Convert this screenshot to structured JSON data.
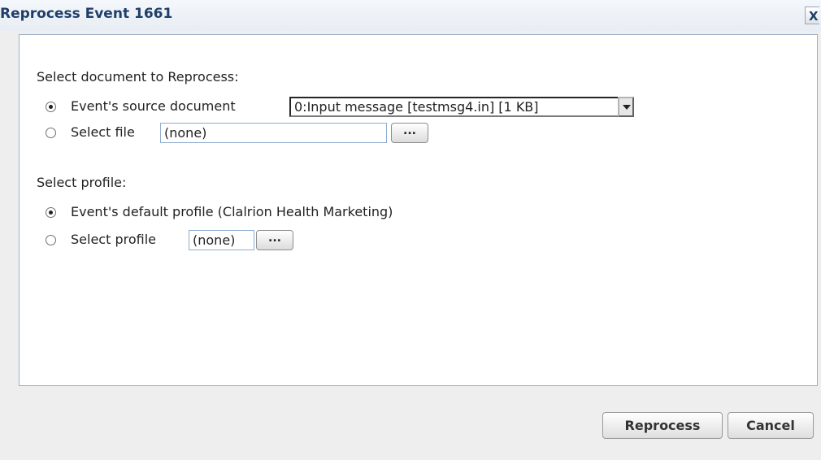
{
  "dialog": {
    "title": "Reprocess Event 1661",
    "close_label": "X"
  },
  "document_section": {
    "label": "Select document to Reprocess:",
    "options": [
      {
        "label": "Event's source document",
        "selected": true,
        "control_value": "0:Input message [testmsg4.in] [1 KB]"
      },
      {
        "label": "Select file",
        "selected": false,
        "control_value": "(none)",
        "browse_label": "..."
      }
    ]
  },
  "profile_section": {
    "label": "Select profile:",
    "options": [
      {
        "label": "Event's default profile (Clalrion Health Marketing)",
        "selected": true
      },
      {
        "label": "Select profile",
        "selected": false,
        "control_value": "(none)",
        "browse_label": "..."
      }
    ]
  },
  "actions": {
    "reprocess_label": "Reprocess",
    "cancel_label": "Cancel"
  }
}
